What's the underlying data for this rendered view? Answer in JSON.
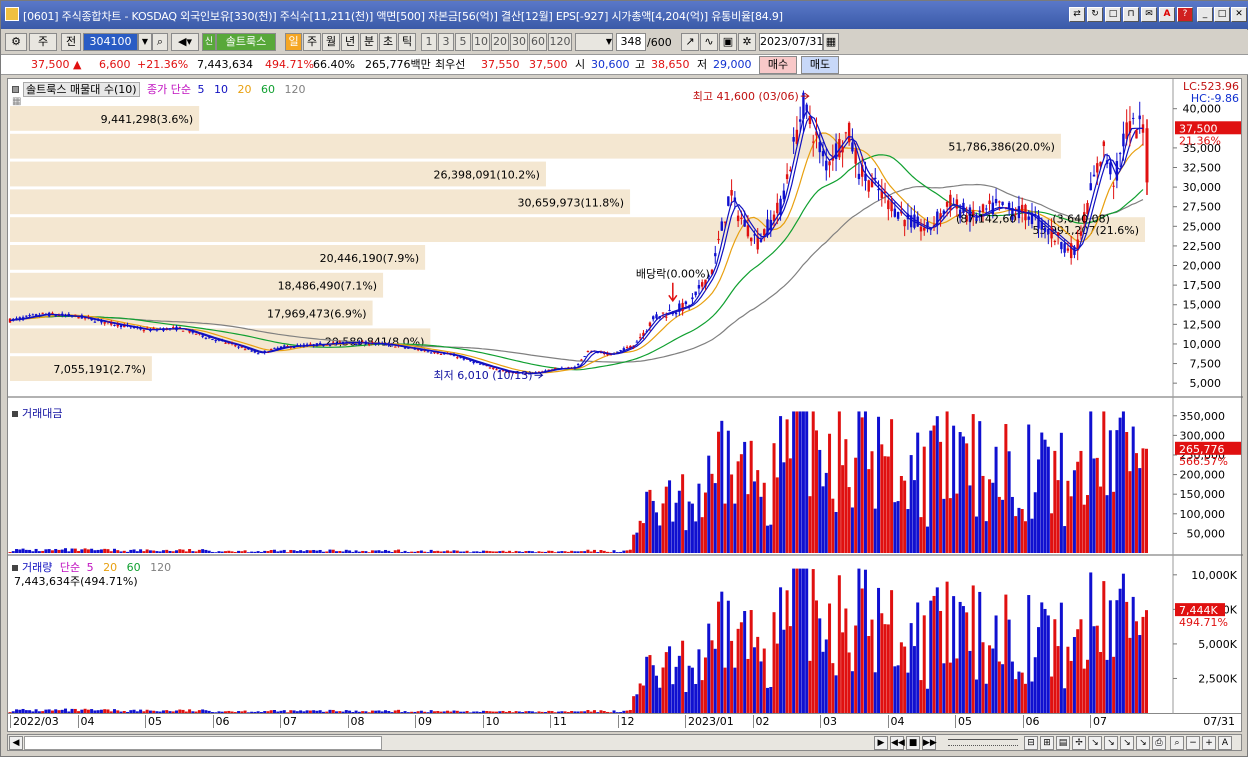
{
  "title_bar": {
    "text": "[0601] 주식종합차트 - KOSDAQ 외국인보유[330(천)] 주식수[11,211(천)] 액면[500] 자본금[56(억)] 결산[12월] EPS[-927] 시가총액[4,204(억)] 유통비율[84.9]"
  },
  "toolbar": {
    "market": "주",
    "exchange": "전",
    "code": "304100",
    "stock_name": "솔트룩스",
    "tab_active": "일",
    "periods": [
      "주",
      "월",
      "년",
      "분",
      "초",
      "틱"
    ],
    "minute_steps": [
      "1",
      "3",
      "5",
      "10",
      "20",
      "30",
      "60",
      "120"
    ],
    "count": "348",
    "count_total": "/600",
    "date": "2023/07/31"
  },
  "quote": {
    "price": "37,500",
    "change": "6,600",
    "change_pct": "+21.36%",
    "volume": "7,443,634",
    "volume_ratio": "494.71%",
    "ratio2": "66.40%",
    "amount": "265,776백만",
    "best_label": "최우선",
    "best_ask": "37,550",
    "best_bid": "37,500",
    "open_label": "시",
    "open": "30,600",
    "high_label": "고",
    "high": "38,650",
    "low_label": "저",
    "low": "29,000",
    "buy_label": "매수",
    "sell_label": "매도"
  },
  "price_panel": {
    "legend_name": "솔트룩스 매물대 수(10)",
    "ma_label": "종가 단순",
    "ma_periods": [
      "5",
      "10",
      "20",
      "60",
      "120"
    ],
    "ma_colors": [
      "#1010c0",
      "#1010c0",
      "#e8a010",
      "#10a030",
      "#808080"
    ],
    "lc_label": "LC:523.96",
    "hc_label": "HC:-9.86",
    "current_price_tag": "37,500",
    "current_pct_tag": "21.36%",
    "y_ticks": [
      "40,000",
      "35,000",
      "32,500",
      "30,000",
      "27,500",
      "25,000",
      "22,500",
      "20,000",
      "17,500",
      "15,000",
      "12,500",
      "10,000",
      "7,500",
      "5,000"
    ],
    "high_annotation": "최고 41,600 (03/06)",
    "low_annotation": "최저 6,010 (10/13)",
    "dividend_annotation": "배당락(0.00%)",
    "volume_profile": [
      {
        "label": "9,441,298(3.6%)",
        "share": 0.036
      },
      {
        "label": "51,786,386(20.0%)",
        "share": 0.2
      },
      {
        "label": "26,398,091(10.2%)",
        "share": 0.102
      },
      {
        "label": "30,659,973(11.8%)",
        "share": 0.118
      },
      {
        "label": "55,991,207(21.6%)",
        "share": 0.216
      },
      {
        "label": "20,446,190(7.9%)",
        "share": 0.079
      },
      {
        "label": "18,486,490(7.1%)",
        "share": 0.071
      },
      {
        "label": "17,969,473(6.9%)",
        "share": 0.069
      },
      {
        "label": "20,589,841(8.0%)",
        "share": 0.08
      },
      {
        "label": "7,055,191(2.7%)",
        "share": 0.027
      }
    ],
    "vp_overlap_labels": [
      "(87,142,60",
      "(3,640,08)"
    ]
  },
  "amount_panel": {
    "legend_name": "거래대금",
    "y_ticks": [
      "350,000",
      "300,000",
      "250,000",
      "200,000",
      "150,000",
      "100,000",
      "50,000"
    ],
    "current_tag": "265,776",
    "current_pct_tag": "566.57%"
  },
  "volume_panel": {
    "legend_name": "거래량",
    "ma_label": "단순",
    "ma_periods": [
      "5",
      "20",
      "60",
      "120"
    ],
    "summary": "7,443,634주(494.71%)",
    "y_ticks": [
      "10,000K",
      "7,500K",
      "5,000K",
      "2,500K"
    ],
    "current_tag": "7,444K",
    "current_pct_tag": "494.71%"
  },
  "x_axis": {
    "labels": [
      "2022/03",
      "04",
      "05",
      "06",
      "07",
      "08",
      "09",
      "10",
      "11",
      "12",
      "2023/01",
      "02",
      "03",
      "04",
      "05",
      "06",
      "07"
    ],
    "end_label": "07/31"
  },
  "chart_data": {
    "type": "candlestick",
    "x_range": [
      "2022/03",
      "2023/07/31"
    ],
    "price_ylim": [
      4000,
      42000
    ],
    "price_path": [
      [
        0,
        13000
      ],
      [
        0.03,
        13800
      ],
      [
        0.06,
        13500
      ],
      [
        0.09,
        12600
      ],
      [
        0.12,
        11800
      ],
      [
        0.15,
        12000
      ],
      [
        0.18,
        10600
      ],
      [
        0.2,
        9800
      ],
      [
        0.22,
        8800
      ],
      [
        0.24,
        9600
      ],
      [
        0.27,
        9900
      ],
      [
        0.3,
        10200
      ],
      [
        0.33,
        10000
      ],
      [
        0.36,
        9300
      ],
      [
        0.39,
        8600
      ],
      [
        0.42,
        7200
      ],
      [
        0.44,
        6400
      ],
      [
        0.46,
        6200
      ],
      [
        0.48,
        6800
      ],
      [
        0.5,
        7000
      ],
      [
        0.51,
        9200
      ],
      [
        0.53,
        8600
      ],
      [
        0.55,
        9800
      ],
      [
        0.57,
        13500
      ],
      [
        0.6,
        15000
      ],
      [
        0.62,
        19500
      ],
      [
        0.635,
        29000
      ],
      [
        0.645,
        26000
      ],
      [
        0.66,
        23000
      ],
      [
        0.68,
        27500
      ],
      [
        0.7,
        40500
      ],
      [
        0.72,
        33000
      ],
      [
        0.74,
        37000
      ],
      [
        0.75,
        32000
      ],
      [
        0.77,
        29000
      ],
      [
        0.79,
        26000
      ],
      [
        0.81,
        24500
      ],
      [
        0.83,
        28000
      ],
      [
        0.85,
        26000
      ],
      [
        0.87,
        27500
      ],
      [
        0.9,
        26500
      ],
      [
        0.92,
        24000
      ],
      [
        0.94,
        21500
      ],
      [
        0.955,
        30000
      ],
      [
        0.965,
        35000
      ],
      [
        0.975,
        30600
      ],
      [
        0.985,
        37500
      ]
    ],
    "amount_ylim": [
      0,
      380000
    ],
    "volume_ylim_k": [
      0,
      11000
    ],
    "last_close": 37500,
    "last_amount": 265776,
    "last_volume_k": 7444
  }
}
